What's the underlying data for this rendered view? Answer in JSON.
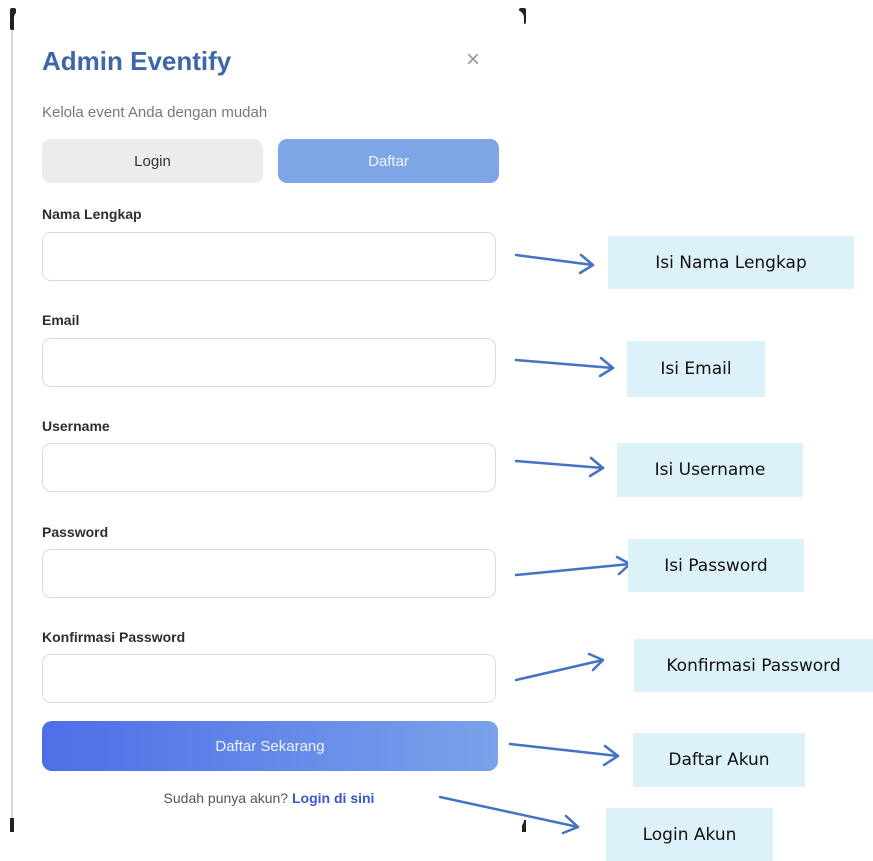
{
  "modal": {
    "title": "Admin Eventify",
    "close_glyph": "×",
    "subtitle": "Kelola event Anda dengan mudah",
    "tabs": [
      {
        "label": "Login",
        "active": false
      },
      {
        "label": "Daftar",
        "active": true
      }
    ],
    "fields": [
      {
        "label": "Nama Lengkap",
        "value": ""
      },
      {
        "label": "Email",
        "value": ""
      },
      {
        "label": "Username",
        "value": ""
      },
      {
        "label": "Password",
        "value": ""
      },
      {
        "label": "Konfirmasi Password",
        "value": ""
      }
    ],
    "submit_label": "Daftar Sekarang",
    "footer": {
      "text": "Sudah punya akun?",
      "link": "Login di sini"
    }
  },
  "annotations": [
    "Isi Nama Lengkap",
    "Isi Email",
    "Isi Username",
    "Isi Password",
    "Konfirmasi Password",
    "Daftar Akun",
    "Login Akun"
  ],
  "colors": {
    "title": "#3d66a8",
    "active_tab": "#7ea6e6",
    "button_gradient_start": "#4e6ee8",
    "button_gradient_end": "#7aa2ea",
    "link": "#3a56c8",
    "callout_bg": "#ddf1f9",
    "arrow": "#4472c4"
  }
}
